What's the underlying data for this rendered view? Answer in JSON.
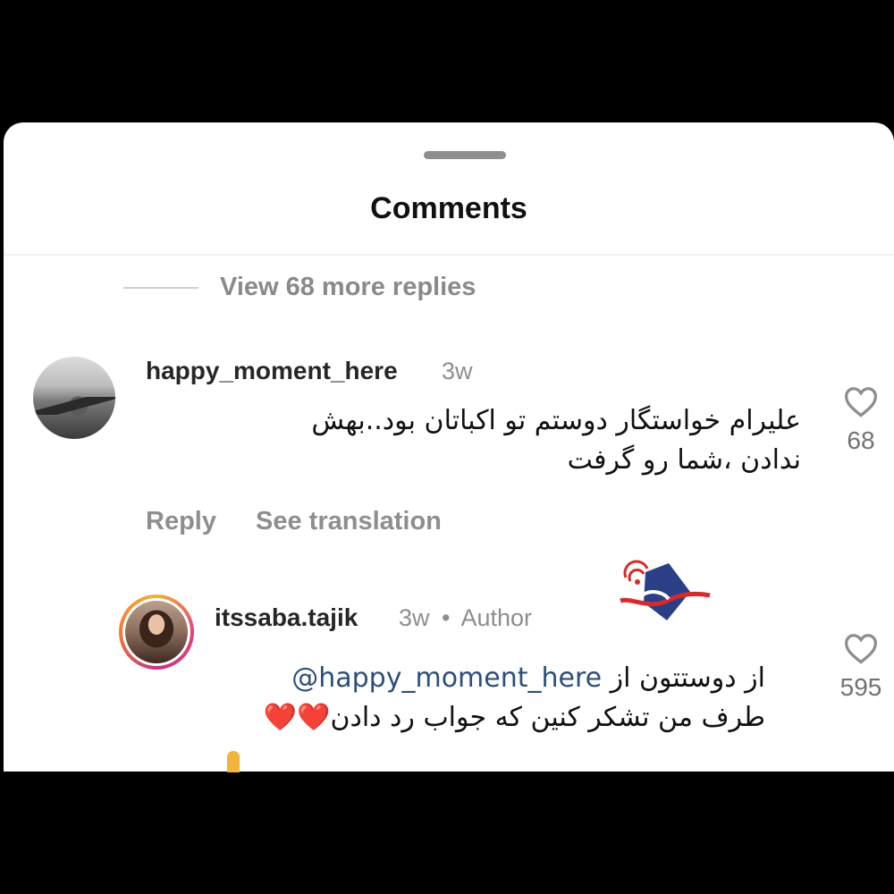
{
  "sheet": {
    "title": "Comments",
    "view_replies": "View 68 more replies"
  },
  "comments": [
    {
      "username": "happy_moment_here",
      "time": "3w",
      "text": "علیرام خواستگار دوستم تو اکباتان بود..بهش ندادن ،شما رو گرفت",
      "reply_label": "Reply",
      "translate_label": "See translation",
      "likes": "68"
    },
    {
      "username": "itssaba.tajik",
      "time": "3w",
      "dot": "•",
      "badge": "Author",
      "mention": "@happy_moment_here",
      "text_prefix": "از دوستتون از",
      "text_rest": "طرف من تشکر کنین که جواب رد دادن",
      "hearts": "❤️❤️",
      "likes": "595"
    }
  ],
  "icons": {
    "like": "heart-outline-icon",
    "watermark": "news-agency-logo"
  },
  "colors": {
    "background": "#000000",
    "sheet": "#ffffff",
    "mention": "#2d4f78",
    "muted": "#8e8e8e"
  }
}
